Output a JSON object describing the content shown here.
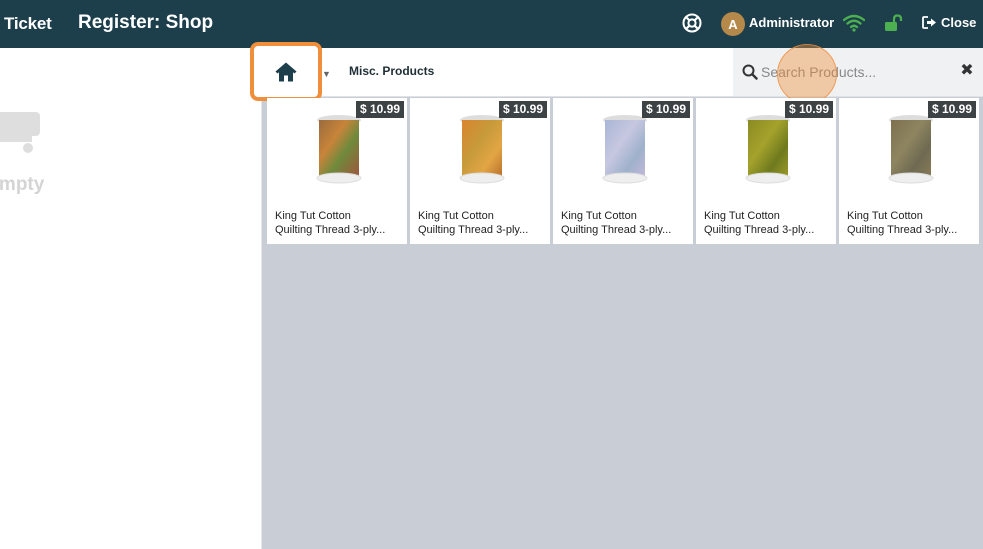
{
  "header": {
    "ticket_fragment": "t Ticket",
    "register_title": "Register: Shop",
    "user_initial": "A",
    "user_name": "Administrator",
    "close_label": "Close",
    "icons": [
      "help-lifebuoy-icon",
      "wifi-icon",
      "unlock-icon",
      "sign-out-icon"
    ]
  },
  "cart": {
    "empty_message": "er is empty",
    "icon": "cart-icon"
  },
  "toolbar": {
    "home_icon": "home-icon",
    "breadcrumb": "Misc. Products",
    "search_placeholder": "Search Products...",
    "search_value": ""
  },
  "products": [
    {
      "price": "$ 10.99",
      "name_line1": "King Tut Cotton",
      "name_line2": "Quilting Thread 3-ply..."
    },
    {
      "price": "$ 10.99",
      "name_line1": "King Tut Cotton",
      "name_line2": "Quilting Thread 3-ply..."
    },
    {
      "price": "$ 10.99",
      "name_line1": "King Tut Cotton",
      "name_line2": "Quilting Thread 3-ply..."
    },
    {
      "price": "$ 10.99",
      "name_line1": "King Tut Cotton",
      "name_line2": "Quilting Thread 3-ply..."
    },
    {
      "price": "$ 10.99",
      "name_line1": "King Tut Cotton",
      "name_line2": "Quilting Thread 3-ply..."
    }
  ],
  "colors": {
    "header_bg": "#1d3f4c",
    "highlight": "#ef8e3b",
    "wifi": "#4caf50",
    "lock": "#4caf50",
    "avatar": "#b5894a",
    "grid_bg": "#c9cdd5",
    "price_badge": "#3d4244"
  }
}
